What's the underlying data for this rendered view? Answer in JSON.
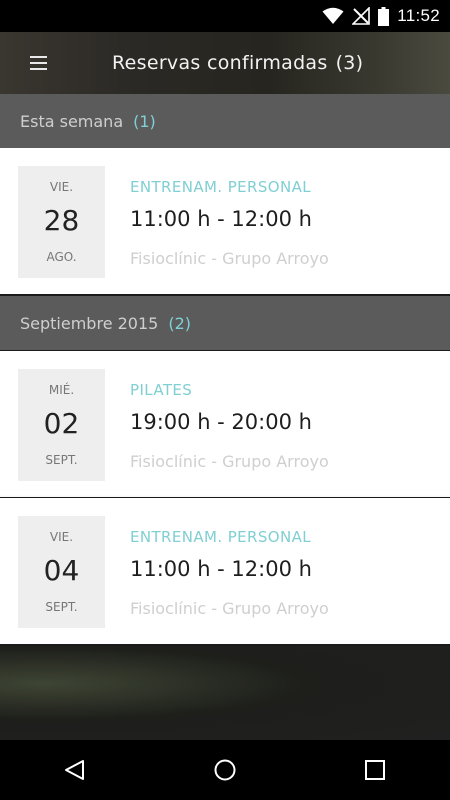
{
  "status_bar": {
    "time": "11:52",
    "icons": [
      "wifi-icon",
      "no-signal-icon",
      "battery-icon"
    ]
  },
  "app_bar": {
    "menu_icon": "menu-icon",
    "title": "Reservas confirmadas",
    "count": "(3)"
  },
  "sections": [
    {
      "label": "Esta semana",
      "count": "(1)",
      "bookings": [
        {
          "dow": "VIE.",
          "day": "28",
          "month": "AGO.",
          "type": "ENTRENAM. PERSONAL",
          "hours": "11:00 h - 12:00 h",
          "place": "Fisioclínic - Grupo Arroyo"
        }
      ]
    },
    {
      "label": "Septiembre 2015",
      "count": "(2)",
      "bookings": [
        {
          "dow": "MIÉ.",
          "day": "02",
          "month": "SEPT.",
          "type": "PILATES",
          "hours": "19:00 h - 20:00 h",
          "place": "Fisioclínic - Grupo Arroyo"
        },
        {
          "dow": "VIE.",
          "day": "04",
          "month": "SEPT.",
          "type": "ENTRENAM. PERSONAL",
          "hours": "11:00 h - 12:00 h",
          "place": "Fisioclínic - Grupo Arroyo"
        }
      ]
    }
  ],
  "nav_bar": {
    "icons": [
      "back-icon",
      "home-icon",
      "recents-icon"
    ]
  },
  "colors": {
    "accent": "#7fd1d6",
    "section_bg": "#5b5b5b",
    "card_bg": "#ffffff",
    "date_box_bg": "#eeeeee"
  }
}
